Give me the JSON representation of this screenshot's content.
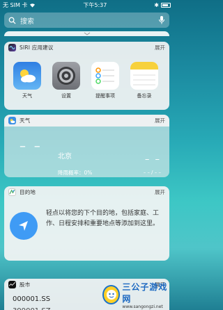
{
  "status_bar": {
    "carrier": "无 SIM 卡",
    "time": "下午5:37"
  },
  "search": {
    "placeholder": "搜索"
  },
  "siri": {
    "title": "SIRI 应用建议",
    "expand": "展开",
    "apps": [
      {
        "label": "天气",
        "icon": "weather-icon"
      },
      {
        "label": "设置",
        "icon": "settings-icon"
      },
      {
        "label": "提醒事项",
        "icon": "reminders-icon"
      },
      {
        "label": "备忘录",
        "icon": "notes-icon"
      }
    ]
  },
  "weather": {
    "title": "天气",
    "expand": "展开",
    "temp_left": "– –",
    "city": "北京",
    "rain_label": "降雨概率：0%",
    "temp_right": "– –",
    "range": "– – / – –"
  },
  "destination": {
    "title": "目的地",
    "expand": "展开",
    "text": "轻点以将您的下个目的地，包括家庭、工作、日程安排和重要地点等添加到这里。"
  },
  "stocks": {
    "title": "股市",
    "expand": "展开",
    "rows": [
      "000001.SS",
      "399001.SZ"
    ]
  },
  "watermark": {
    "name": "三公子游戏网",
    "url": "www.sangongzi.net"
  },
  "colors": {
    "weather_blue": "#3b8fe4",
    "notes_yellow": "#f7d13c",
    "nav_blue": "#3f9bf5"
  }
}
